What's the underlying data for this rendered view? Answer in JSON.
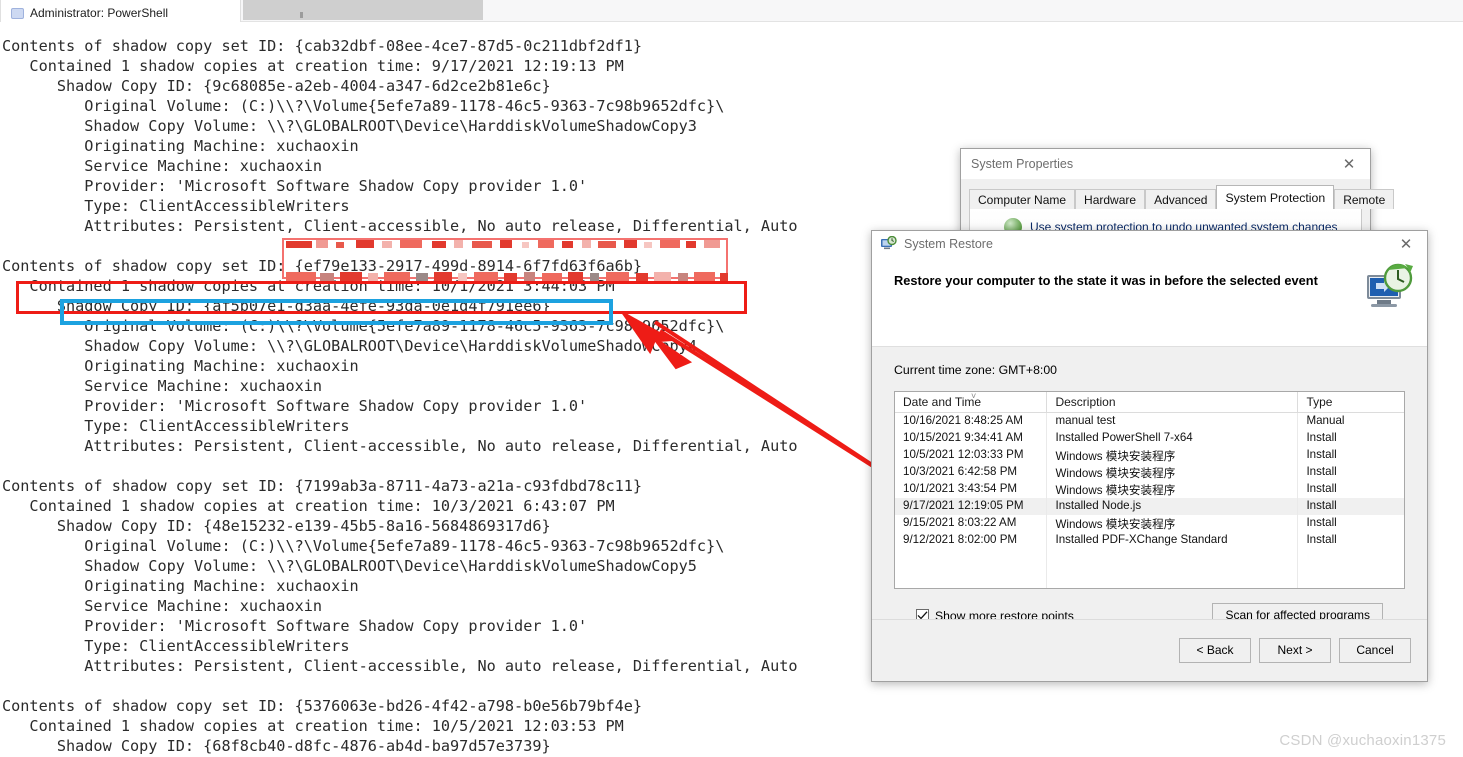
{
  "terminal": {
    "tab_label": "Administrator: PowerShell",
    "lines": [
      "Contents of shadow copy set ID: {cab32dbf-08ee-4ce7-87d5-0c211dbf2df1}",
      "   Contained 1 shadow copies at creation time: 9/17/2021 12:19:13 PM",
      "      Shadow Copy ID: {9c68085e-a2eb-4004-a347-6d2ce2b81e6c}",
      "         Original Volume: (C:)\\\\?\\Volume{5efe7a89-1178-46c5-9363-7c98b9652dfc}\\",
      "         Shadow Copy Volume: \\\\?\\GLOBALROOT\\Device\\HarddiskVolumeShadowCopy3",
      "         Originating Machine: xuchaoxin",
      "         Service Machine: xuchaoxin",
      "         Provider: 'Microsoft Software Shadow Copy provider 1.0'",
      "         Type: ClientAccessibleWriters",
      "         Attributes: Persistent, Client-accessible, No auto release, Differential, Auto",
      "",
      "Contents of shadow copy set ID: {ef79e133-2917-499d-8914-6f7fd63f6a6b}",
      "   Contained 1 shadow copies at creation time: 10/1/2021 3:44:03 PM",
      "      Shadow Copy ID: {af5b07e1-d3aa-4efe-93da-0e1d4f791ee6}",
      "         Original Volume: (C:)\\\\?\\Volume{5efe7a89-1178-46c5-9363-7c98b9652dfc}\\",
      "         Shadow Copy Volume: \\\\?\\GLOBALROOT\\Device\\HarddiskVolumeShadowCopy4",
      "         Originating Machine: xuchaoxin",
      "         Service Machine: xuchaoxin",
      "         Provider: 'Microsoft Software Shadow Copy provider 1.0'",
      "         Type: ClientAccessibleWriters",
      "         Attributes: Persistent, Client-accessible, No auto release, Differential, Auto",
      "",
      "Contents of shadow copy set ID: {7199ab3a-8711-4a73-a21a-c93fdbd78c11}",
      "   Contained 1 shadow copies at creation time: 10/3/2021 6:43:07 PM",
      "      Shadow Copy ID: {48e15232-e139-45b5-8a16-5684869317d6}",
      "         Original Volume: (C:)\\\\?\\Volume{5efe7a89-1178-46c5-9363-7c98b9652dfc}\\",
      "         Shadow Copy Volume: \\\\?\\GLOBALROOT\\Device\\HarddiskVolumeShadowCopy5",
      "         Originating Machine: xuchaoxin",
      "         Service Machine: xuchaoxin",
      "         Provider: 'Microsoft Software Shadow Copy provider 1.0'",
      "         Type: ClientAccessibleWriters",
      "         Attributes: Persistent, Client-accessible, No auto release, Differential, Auto",
      "",
      "Contents of shadow copy set ID: {5376063e-bd26-4f42-a798-b0e56b79bf4e}",
      "   Contained 1 shadow copies at creation time: 10/5/2021 12:03:53 PM",
      "      Shadow Copy ID: {68f8cb40-d8fc-4876-ab4d-ba97d57e3739}"
    ]
  },
  "annotations": {
    "highlight_red_color": "#ee1c16",
    "highlight_blue_color": "#1ca2e0",
    "red_box_target_line": "Contained 1 shadow copies at creation time: 10/1/2021 3:44:03 PM",
    "blue_box_target_line": "Shadow Copy ID: {af5b07e1-d3aa-4efe-93da-0e1d4f791ee6}",
    "arrow_from_table_row": "10/1/2021 3:43:54 PM"
  },
  "system_properties": {
    "title": "System Properties",
    "close_icon": "close-icon",
    "tabs": [
      {
        "label": "Computer Name",
        "active": false
      },
      {
        "label": "Hardware",
        "active": false
      },
      {
        "label": "Advanced",
        "active": false
      },
      {
        "label": "System Protection",
        "active": true
      },
      {
        "label": "Remote",
        "active": false
      }
    ],
    "page_text": "Use system protection to undo unwanted system changes"
  },
  "system_restore": {
    "title": "System Restore",
    "title_icon": "system-restore-icon",
    "close_icon": "close-icon",
    "heading": "Restore your computer to the state it was in before the selected event",
    "timezone": "Current time zone: GMT+8:00",
    "columns": [
      "Date and Time",
      "Description",
      "Type"
    ],
    "sort_column": "Date and Time",
    "rows": [
      {
        "date": "10/16/2021 8:48:25 AM",
        "description": "manual test",
        "type": "Manual",
        "selected": false
      },
      {
        "date": "10/15/2021 9:34:41 AM",
        "description": "Installed PowerShell 7-x64",
        "type": "Install",
        "selected": false
      },
      {
        "date": "10/5/2021 12:03:33 PM",
        "description": "Windows 模块安装程序",
        "type": "Install",
        "selected": false
      },
      {
        "date": "10/3/2021 6:42:58 PM",
        "description": "Windows 模块安装程序",
        "type": "Install",
        "selected": false
      },
      {
        "date": "10/1/2021 3:43:54 PM",
        "description": "Windows 模块安装程序",
        "type": "Install",
        "selected": false
      },
      {
        "date": "9/17/2021 12:19:05 PM",
        "description": "Installed Node.js",
        "type": "Install",
        "selected": true
      },
      {
        "date": "9/15/2021 8:03:22 AM",
        "description": "Windows 模块安装程序",
        "type": "Install",
        "selected": false
      },
      {
        "date": "9/12/2021 8:02:00 PM",
        "description": "Installed PDF-XChange Standard",
        "type": "Install",
        "selected": false
      }
    ],
    "show_more_label": "Show more restore points",
    "show_more_checked": true,
    "scan_button": "Scan for affected programs",
    "back_button": "< Back",
    "next_button": "Next >",
    "cancel_button": "Cancel"
  },
  "watermark": "CSDN @xuchaoxin1375"
}
